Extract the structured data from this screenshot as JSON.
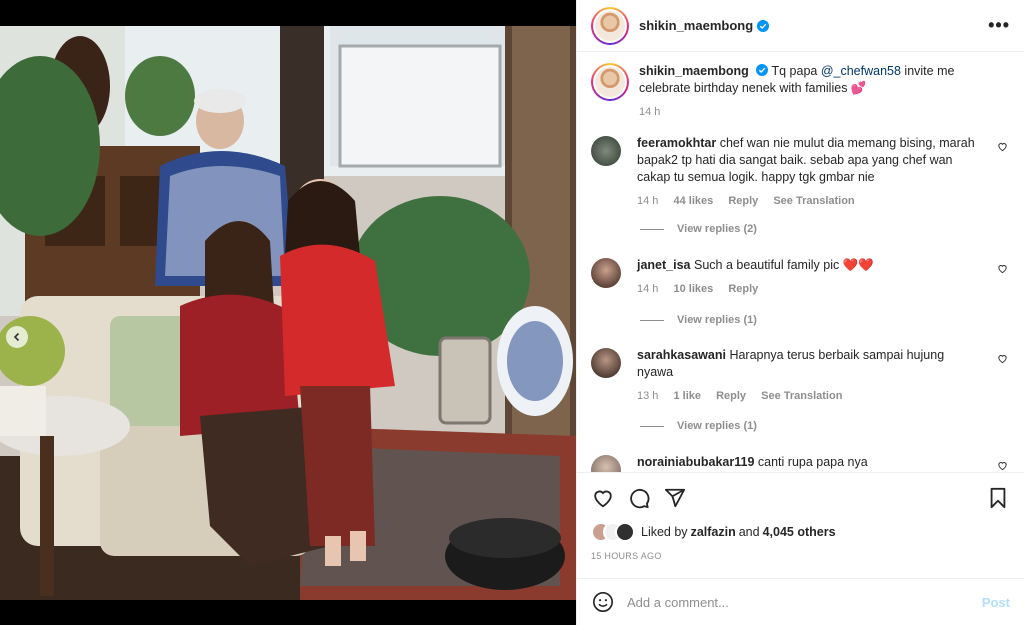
{
  "post": {
    "username": "shikin_maembong",
    "more_icon": "more-horizontal-icon",
    "caption": {
      "username": "shikin_maembong",
      "text_before": "Tq papa ",
      "mention": "@_chefwan58",
      "text_after": " invite me celebrate birthday nenek with families 💕",
      "time": "14 h"
    },
    "media": {
      "description_icon": "family-photo",
      "dots": 2,
      "active_dot": 0
    }
  },
  "comments": [
    {
      "username": "feeramokhtar",
      "text": "chef wan nie mulut dia memang bising, marah bapak2 tp hati dia sangat baik. sebab apa yang chef wan cakap tu semua logik. happy tgk gmbar nie",
      "time": "14 h",
      "likes": "44 likes",
      "reply": "Reply",
      "translation": "See Translation",
      "view_replies": "View replies (2)"
    },
    {
      "username": "janet_isa",
      "text": "Such a beautiful family pic ❤️❤️",
      "time": "14 h",
      "likes": "10 likes",
      "reply": "Reply",
      "view_replies": "View replies (1)"
    },
    {
      "username": "sarahkasawani",
      "text": "Harapnya terus berbaik sampai hujung nyawa",
      "time": "13 h",
      "likes": "1 like",
      "reply": "Reply",
      "translation": "See Translation",
      "view_replies": "View replies (1)"
    },
    {
      "username": "norainiabubakar119",
      "text": "canti rupa papa nya"
    }
  ],
  "likes": {
    "prefix": "Liked by ",
    "user": "zalfazin",
    "middle": " and ",
    "others": "4,045 others"
  },
  "posted": "15 HOURS AGO",
  "add_comment": {
    "placeholder": "Add a comment...",
    "post_label": "Post"
  },
  "colors": {
    "link": "#00376b",
    "muted": "#8e8e8e",
    "post_disabled": "#b2dffc",
    "verified": "#0095f6"
  }
}
